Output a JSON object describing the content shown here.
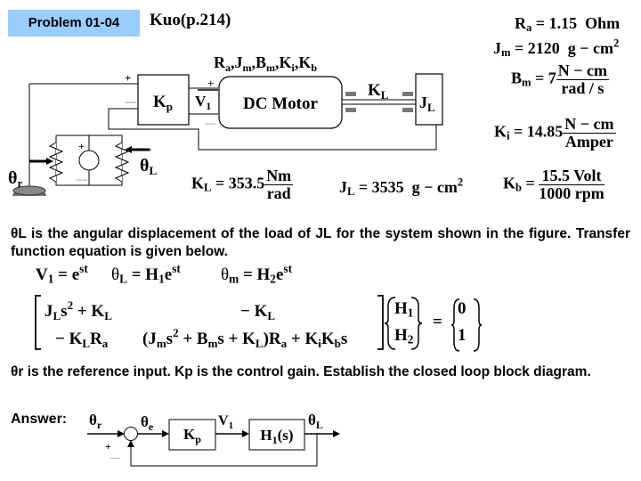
{
  "header": {
    "problem_label": "Problem 01-04",
    "source": "Kuo(p.214)",
    "badge_color": "#99ccff"
  },
  "diagram": {
    "motor_params": "Ra, Jm, Bm, Ki, Kb",
    "motor_label": "DC Motor",
    "gain_label": "Kp",
    "voltage_label": "V1",
    "shaft_label": "KL",
    "load_label": "JL",
    "theta_r": "θr",
    "theta_L": "θL",
    "plus": "+",
    "minus": "—"
  },
  "parameters": {
    "Ra": {
      "symbol": "Ra",
      "value": "1.15",
      "unit": "Ohm"
    },
    "Jm": {
      "symbol": "Jm",
      "value": "2120",
      "unit": "g − cm²"
    },
    "Bm": {
      "symbol": "Bm",
      "value": "7",
      "unit_num": "N − cm",
      "unit_den": "rad / s"
    },
    "Ki": {
      "symbol": "Ki",
      "value": "14.85",
      "unit_num": "N − cm",
      "unit_den": "Amper"
    },
    "Kb": {
      "symbol": "Kb",
      "num": "15.5  Volt",
      "den": "1000  rpm"
    },
    "KL": {
      "symbol": "KL",
      "value": "353.5",
      "unit_num": "Nm",
      "unit_den": "rad"
    },
    "JL": {
      "symbol": "JL",
      "value": "3535",
      "unit": "g − cm²"
    }
  },
  "text": {
    "paragraph1": "θL is the angular displacement of the load of JL for the system shown in the figure. Transfer function equation is given below.",
    "paragraph2": "θr is the reference input. Kp is the control gain. Establish the closed loop block diagram.",
    "answer_label": "Answer:"
  },
  "equations": {
    "assumptions": [
      "V1 = e^st",
      "θL = H1 e^st",
      "θm = H2 e^st"
    ],
    "matrix": [
      [
        "JL s² + KL",
        "− KL"
      ],
      [
        "− KL Ra",
        "(Jm s² + Bm s + KL) Ra + Ki Kb s"
      ]
    ],
    "unknowns": [
      "H1",
      "H2"
    ],
    "rhs": [
      "0",
      "1"
    ]
  },
  "block_diagram": {
    "input": "θr",
    "error": "θe",
    "controller": "Kp",
    "intermediate": "V1",
    "plant": "H1(s)",
    "output": "θL",
    "sum_plus": "+",
    "sum_minus": "—"
  }
}
